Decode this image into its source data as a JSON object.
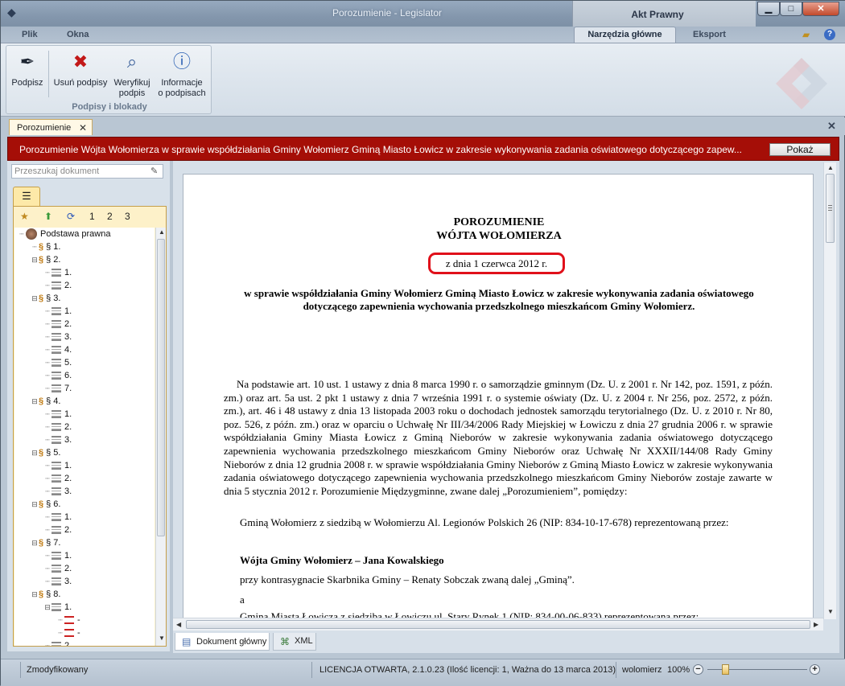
{
  "window": {
    "title": "Porozumienie - Legislator",
    "context_title": "Akt Prawny"
  },
  "ribbon_tabs": {
    "plik": "Plik",
    "okna": "Okna",
    "narzedzia": "Narzędzia główne",
    "eksport": "Eksport"
  },
  "ribbon": {
    "podpisz": "Podpisz",
    "usun": "Usuń podpisy",
    "weryfikuj_1": "Weryfikuj",
    "weryfikuj_2": "podpis",
    "info_1": "Informacje",
    "info_2": "o podpisach",
    "group_label": "Podpisy i blokady"
  },
  "doc_tab": {
    "label": "Porozumienie"
  },
  "banner": {
    "text": "Porozumienie Wójta Wołomierza w sprawie współdziałania Gminy Wołomierz Gminą Miasto Łowicz w zakresie wykonywania zadania oświatowego dotyczącego zapew...",
    "button": "Pokaż"
  },
  "navigator": {
    "search_placeholder": "Przeszukaj dokument",
    "levels": [
      "1",
      "2",
      "3"
    ],
    "tree": [
      {
        "label": "Podstawa prawna",
        "kind": "root",
        "indent": 0
      },
      {
        "label": "§ 1.",
        "kind": "par",
        "indent": 1
      },
      {
        "label": "§ 2.",
        "kind": "par",
        "indent": 1,
        "open": true
      },
      {
        "label": "1.",
        "kind": "doc",
        "indent": 2
      },
      {
        "label": "2.",
        "kind": "doc",
        "indent": 2
      },
      {
        "label": "§ 3.",
        "kind": "par",
        "indent": 1,
        "open": true
      },
      {
        "label": "1.",
        "kind": "doc",
        "indent": 2
      },
      {
        "label": "2.",
        "kind": "doc",
        "indent": 2
      },
      {
        "label": "3.",
        "kind": "doc",
        "indent": 2
      },
      {
        "label": "4.",
        "kind": "doc",
        "indent": 2
      },
      {
        "label": "5.",
        "kind": "doc",
        "indent": 2
      },
      {
        "label": "6.",
        "kind": "doc",
        "indent": 2
      },
      {
        "label": "7.",
        "kind": "doc",
        "indent": 2
      },
      {
        "label": "§ 4.",
        "kind": "par",
        "indent": 1,
        "open": true
      },
      {
        "label": "1.",
        "kind": "doc",
        "indent": 2
      },
      {
        "label": "2.",
        "kind": "doc",
        "indent": 2
      },
      {
        "label": "3.",
        "kind": "doc",
        "indent": 2
      },
      {
        "label": "§ 5.",
        "kind": "par",
        "indent": 1,
        "open": true
      },
      {
        "label": "1.",
        "kind": "doc",
        "indent": 2
      },
      {
        "label": "2.",
        "kind": "doc",
        "indent": 2
      },
      {
        "label": "3.",
        "kind": "doc",
        "indent": 2
      },
      {
        "label": "§ 6.",
        "kind": "par",
        "indent": 1,
        "open": true
      },
      {
        "label": "1.",
        "kind": "doc",
        "indent": 2
      },
      {
        "label": "2.",
        "kind": "doc",
        "indent": 2
      },
      {
        "label": "§ 7.",
        "kind": "par",
        "indent": 1,
        "open": true
      },
      {
        "label": "1.",
        "kind": "doc",
        "indent": 2
      },
      {
        "label": "2.",
        "kind": "doc",
        "indent": 2
      },
      {
        "label": "3.",
        "kind": "doc",
        "indent": 2
      },
      {
        "label": "§ 8.",
        "kind": "par",
        "indent": 1,
        "open": true
      },
      {
        "label": "1.",
        "kind": "doc",
        "indent": 2,
        "open": true
      },
      {
        "label": "-",
        "kind": "red",
        "indent": 3
      },
      {
        "label": "-",
        "kind": "red",
        "indent": 3
      },
      {
        "label": "2.",
        "kind": "doc",
        "indent": 2
      }
    ]
  },
  "document": {
    "title_1": "POROZUMIENIE",
    "title_2": "WÓJTA WOŁOMIERZA",
    "date": "z dnia 1 czerwca 2012 r.",
    "subject": "w sprawie współdziałania Gminy Wołomierz Gminą Miasto Łowicz w zakresie wykonywania zadania oświatowego dotyczącego zapewnienia wychowania przedszkolnego mieszkańcom Gminy Wołomierz.",
    "para_1": "Na podstawie art. 10 ust. 1 ustawy z dnia 8 marca 1990 r. o samorządzie gminnym (Dz. U. z 2001 r. Nr 142, poz. 1591, z późn. zm.) oraz art. 5a ust. 2 pkt 1 ustawy z dnia 7 września 1991 r. o systemie oświaty (Dz. U. z 2004 r. Nr 256, poz. 2572, z późn. zm.), art. 46 i 48 ustawy z dnia 13 listopada 2003 roku o dochodach jednostek samorządu terytorialnego (Dz. U. z 2010 r. Nr 80, poz. 526, z późn. zm.) oraz w oparciu o Uchwałę Nr III/34/2006 Rady Miejskiej w Łowiczu z dnia 27 grudnia 2006 r. w sprawie współdziałania Gminy Miasta Łowicz z Gminą Nieborów w zakresie wykonywania zadania oświatowego dotyczącego zapewnienia wychowania przedszkolnego mieszkańcom Gminy Nieborów oraz Uchwałę Nr XXXII/144/08 Rady Gminy Nieborów z dnia 12 grudnia 2008 r. w sprawie współdziałania Gminy Nieborów z Gminą Miasto Łowicz w zakresie wykonywania zadania oświatowego dotyczącego zapewnienia wychowania przedszkolnego mieszkańcom Gminy Nieborów zostaje zawarte w dnia 5 stycznia 2012 r. Porozumienie Międzygminne, zwane dalej „Porozumieniem”, pomiędzy:",
    "party_1": "Gminą Wołomierz z siedzibą w Wołomierzu Al. Legionów Polskich 26 (NIP: 834-10-17-678) reprezentowaną przez:",
    "rep_1": "Wójta Gminy Wołomierz – Jana Kowalskiego",
    "counter": "przy kontrasygnacie Skarbnika Gminy – Renaty Sobczak zwaną dalej „Gminą”.",
    "and": "a",
    "party_2": "Gminą Miasta Łowicza z siedzibą w Łowiczu ul. Stary Rynek 1 (NIP: 834-00-06-833) reprezentowaną przez:"
  },
  "bottom_tabs": {
    "main": "Dokument główny",
    "xml": "XML"
  },
  "status": {
    "state": "Zmodyfikowany",
    "license": "LICENCJA OTWARTA, 2.1.0.23 (Ilość licencji: 1, Ważna do 13 marca 2013)",
    "zoom_label": "wolomierz",
    "zoom": "100%"
  },
  "colors": {
    "banner": "#a50e07",
    "date_highlight": "#e0101a",
    "navigator_bg": "#fdf1c9"
  }
}
